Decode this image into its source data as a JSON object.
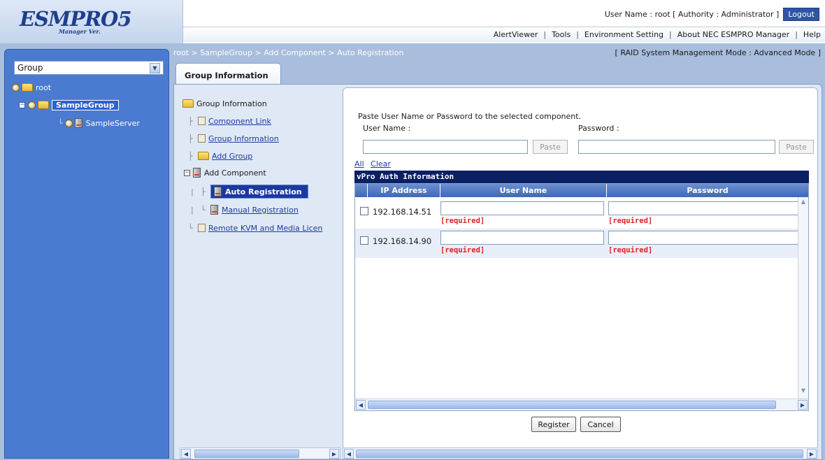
{
  "app": {
    "logo": "ESMPRO5",
    "logo_sub": "Manager Ver."
  },
  "userbar": {
    "text": "User Name : root  [ Authority : Administrator ]",
    "logout": "Logout"
  },
  "menu": [
    "AlertViewer",
    "Tools",
    "Environment Setting",
    "About NEC ESMPRO Manager",
    "Help"
  ],
  "breadcrumb": "root > SampleGroup > Add Component > Auto Registration",
  "mode": "[ RAID System Management Mode : Advanced Mode ]",
  "sidebar": {
    "group_select": "Group",
    "tree": {
      "root": "root",
      "group": "SampleGroup",
      "server": "SampleServer"
    }
  },
  "tab": "Group Information",
  "nav": {
    "title": "Group Information",
    "component_link": "Component Link",
    "group_information": "Group Information",
    "add_group": "Add Group",
    "add_component": "Add Component",
    "auto_registration": "Auto Registration",
    "manual_registration": "Manual Registration",
    "remote_kvm": "Remote KVM and Media Licen"
  },
  "form": {
    "instruction": "Paste User Name or Password to the selected component.",
    "user_label": "User Name :",
    "password_label": "Password :",
    "paste": "Paste",
    "all": "All",
    "clear": "Clear"
  },
  "grid": {
    "title": "vPro Auth Information",
    "headers": [
      "IP Address",
      "User Name",
      "Password"
    ],
    "rows": [
      {
        "ip": "192.168.14.51",
        "user_req": "[required]",
        "pass_req": "[required]"
      },
      {
        "ip": "192.168.14.90",
        "user_req": "[required]",
        "pass_req": "[required]"
      }
    ]
  },
  "buttons": {
    "register": "Register",
    "cancel": "Cancel"
  },
  "colors": {
    "sidebar": "#4a7bd1",
    "header_bar": "#0b1f63",
    "required": "#e0201f",
    "selection": "#1b3a9f"
  }
}
